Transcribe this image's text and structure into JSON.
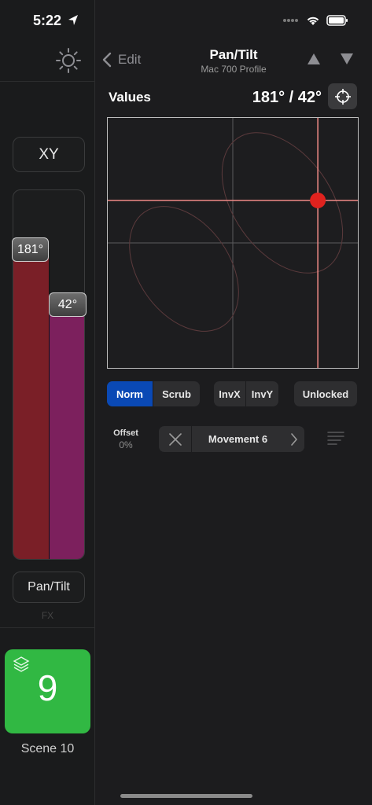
{
  "status_bar": {
    "time": "5:22"
  },
  "left_panel": {
    "mode_button": "XY",
    "faders": [
      {
        "label": "181°",
        "level": 0.84,
        "color": "#7a1f27"
      },
      {
        "label": "42°",
        "level": 0.69,
        "color": "#7c205d"
      }
    ],
    "attribute_button": "Pan/Tilt",
    "fx_label": "FX",
    "scene": {
      "number": "9",
      "name": "Scene 10",
      "color": "#31b843"
    }
  },
  "nav": {
    "back_label": "Edit",
    "title": "Pan/Tilt",
    "subtitle": "Mac 700 Profile"
  },
  "values": {
    "label": "Values",
    "readout": "181° / 42°"
  },
  "xy_pad": {
    "point_x": 0.84,
    "point_y": 0.33,
    "point_color": "#e0221e",
    "crosshair_color": "#f08a86"
  },
  "controls": {
    "mode_norm": "Norm",
    "mode_scrub": "Scrub",
    "inv_x": "InvX",
    "inv_y": "InvY",
    "lock": "Unlocked",
    "accent": "#0a49b5"
  },
  "offset": {
    "title": "Offset",
    "value": "0%"
  },
  "movement": {
    "name": "Movement 6"
  }
}
